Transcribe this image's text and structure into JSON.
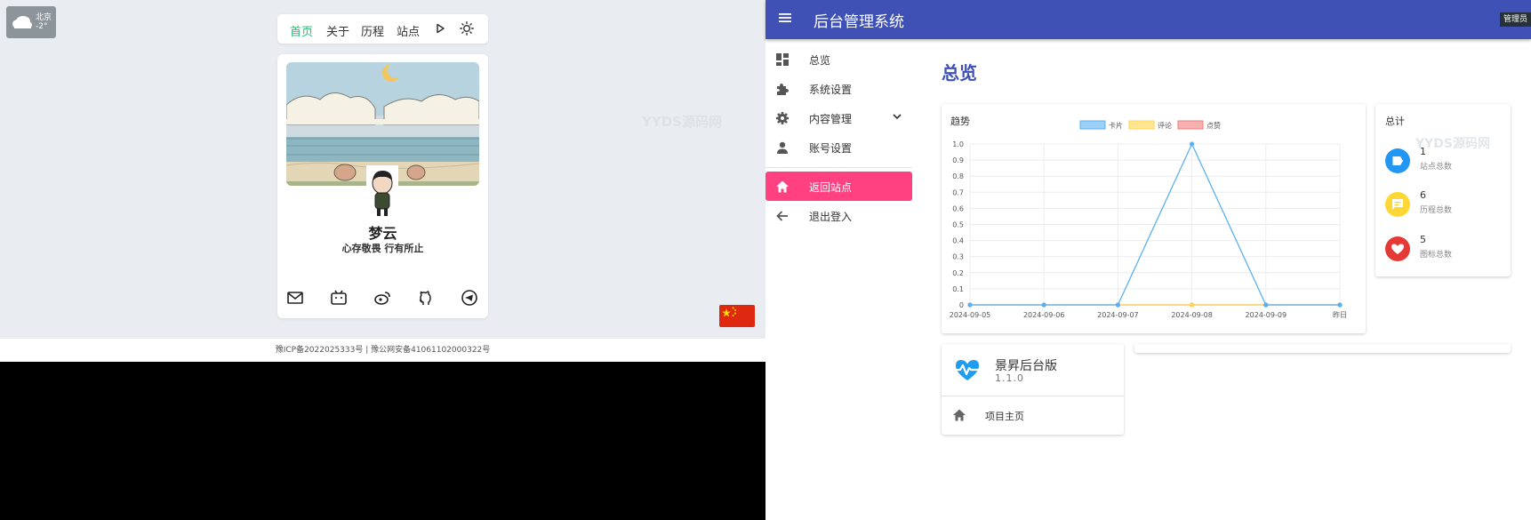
{
  "weather": {
    "city": "北京",
    "temp": "-2°"
  },
  "nav": {
    "items": [
      "首页",
      "关于",
      "历程",
      "站点"
    ]
  },
  "profile": {
    "name": "梦云",
    "motto": "心存敬畏 行有所止"
  },
  "footer": {
    "text": "豫ICP备2022025333号 | 豫公网安备41061102000322号"
  },
  "watermark": "YYDS源码网",
  "admin": {
    "title": "后台管理系统",
    "role": "管理员",
    "sidebar": [
      {
        "label": "总览",
        "icon": "dashboard-icon"
      },
      {
        "label": "系统设置",
        "icon": "puzzle-icon"
      },
      {
        "label": "内容管理",
        "icon": "gear-icon"
      },
      {
        "label": "账号设置",
        "icon": "person-icon"
      },
      {
        "label": "返回站点",
        "icon": "home-icon"
      },
      {
        "label": "退出登入",
        "icon": "arrow-left-icon"
      }
    ],
    "page_title": "总览",
    "trend_title": "趋势",
    "total": {
      "title": "总计",
      "stats": [
        {
          "value": "1",
          "label": "站点总数",
          "color": "#2196f3",
          "icon": "label-icon"
        },
        {
          "value": "6",
          "label": "历程总数",
          "color": "#fdd835",
          "icon": "message-icon"
        },
        {
          "value": "5",
          "label": "图标总数",
          "color": "#e53935",
          "icon": "heart-icon"
        }
      ]
    },
    "version": {
      "name": "景昇后台版",
      "number": "1.1.0",
      "link": "项目主页"
    }
  },
  "chart_data": {
    "type": "line",
    "categories": [
      "2024-09-05",
      "2024-09-06",
      "2024-09-07",
      "2024-09-08",
      "2024-09-09",
      "昨日"
    ],
    "series": [
      {
        "name": "卡片",
        "values": [
          0,
          0,
          0,
          1,
          0,
          0
        ],
        "color": "#5ab1ef"
      },
      {
        "name": "评论",
        "values": [
          0,
          0,
          0,
          0,
          0,
          0
        ],
        "color": "#ffd54f"
      },
      {
        "name": "点赞",
        "values": [
          0,
          0,
          0,
          0,
          0,
          0
        ],
        "color": "#ef7b7b"
      }
    ],
    "yticks": [
      "0",
      "0.1",
      "0.2",
      "0.3",
      "0.4",
      "0.5",
      "0.6",
      "0.7",
      "0.8",
      "0.9",
      "1.0"
    ],
    "ylim": [
      0,
      1
    ],
    "legend": "top-center",
    "grid": true
  }
}
